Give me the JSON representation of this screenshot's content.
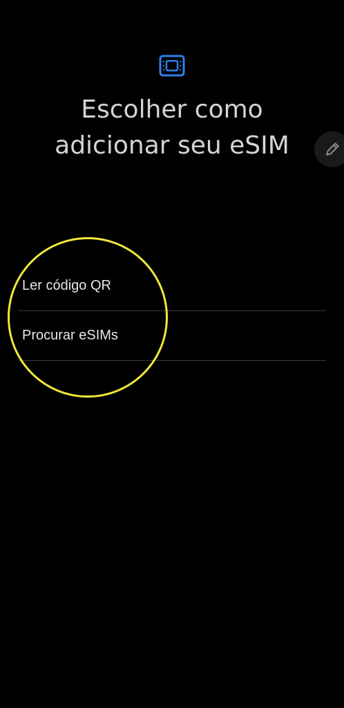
{
  "header": {
    "icon": "esim-card-icon",
    "title_line1": "Escolher como",
    "title_line2": "adicionar seu eSIM"
  },
  "edit_button": {
    "icon": "pencil-icon"
  },
  "options": [
    {
      "label": "Ler código QR"
    },
    {
      "label": "Procurar eSIMs"
    }
  ],
  "colors": {
    "background": "#000000",
    "accent": "#2f7fe6",
    "highlight": "#f0e83a",
    "divider": "#3a3a3a"
  }
}
